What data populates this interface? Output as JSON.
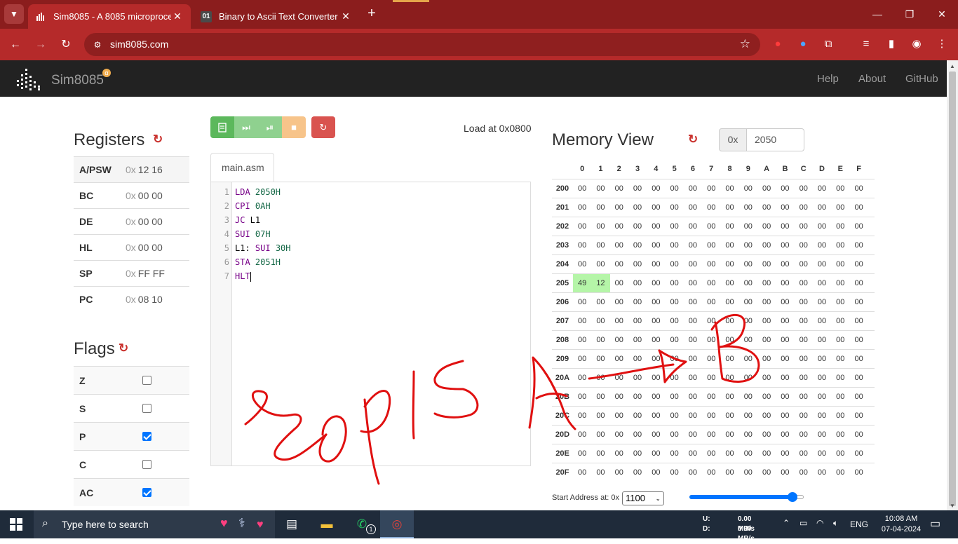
{
  "browser": {
    "tabs": [
      {
        "title": "Sim8085 - A 8085 microprocessor",
        "active": true
      },
      {
        "title": "Binary to Ascii Text Converter",
        "icon_text": "01",
        "active": false
      }
    ],
    "url": "sim8085.com"
  },
  "site": {
    "brand": "Sim8085",
    "nav": [
      "Help",
      "About",
      "GitHub"
    ]
  },
  "registers": {
    "title": "Registers",
    "prefix": "0x",
    "rows": [
      {
        "name": "A/PSW",
        "value": "12 16"
      },
      {
        "name": "BC",
        "value": "00 00"
      },
      {
        "name": "DE",
        "value": "00 00"
      },
      {
        "name": "HL",
        "value": "00 00"
      },
      {
        "name": "SP",
        "value": "FF FF"
      },
      {
        "name": "PC",
        "value": "08 10"
      }
    ]
  },
  "flags": {
    "title": "Flags",
    "rows": [
      {
        "name": "Z",
        "checked": false
      },
      {
        "name": "S",
        "checked": false
      },
      {
        "name": "P",
        "checked": true
      },
      {
        "name": "C",
        "checked": false
      },
      {
        "name": "AC",
        "checked": true
      }
    ]
  },
  "editor": {
    "load_at": "Load at 0x0800",
    "tab": "main.asm",
    "lines": [
      [
        {
          "t": "LDA",
          "c": "kw"
        },
        {
          "t": " 2050H",
          "c": "num"
        }
      ],
      [
        {
          "t": "CPI",
          "c": "kw"
        },
        {
          "t": " 0AH",
          "c": "num"
        }
      ],
      [
        {
          "t": "JC",
          "c": "kw"
        },
        {
          "t": " L1",
          "c": "txt"
        }
      ],
      [
        {
          "t": "SUI",
          "c": "kw"
        },
        {
          "t": " 07H",
          "c": "num"
        }
      ],
      [
        {
          "t": "L1: ",
          "c": "txt"
        },
        {
          "t": "SUI",
          "c": "kw"
        },
        {
          "t": " 30H",
          "c": "num"
        }
      ],
      [
        {
          "t": "STA",
          "c": "kw"
        },
        {
          "t": " 2051H",
          "c": "num"
        }
      ],
      [
        {
          "t": "HLT",
          "c": "kw"
        }
      ]
    ]
  },
  "memory": {
    "title": "Memory View",
    "addr_prefix": "0x",
    "addr_value": "2050",
    "columns": [
      "0",
      "1",
      "2",
      "3",
      "4",
      "5",
      "6",
      "7",
      "8",
      "9",
      "A",
      "B",
      "C",
      "D",
      "E",
      "F"
    ],
    "row_labels": [
      "200",
      "201",
      "202",
      "203",
      "204",
      "205",
      "206",
      "207",
      "208",
      "209",
      "20A",
      "20B",
      "20C",
      "20D",
      "20E",
      "20F"
    ],
    "special": {
      "205": [
        "49",
        "12"
      ]
    },
    "fill": "00",
    "start_address_label": "Start Address at: 0x",
    "start_address_value": "1100",
    "slider_level": 0.9
  },
  "taskbar": {
    "search_placeholder": "Type here to search",
    "net_up": "U:",
    "net_down": "D:",
    "net_up_rate": "0.00 MB/s",
    "net_down_rate": "0.00 MB/s",
    "lang": "ENG",
    "time": "10:08 AM",
    "date": "07-04-2024",
    "whatsapp_badge": "1"
  },
  "colors": {
    "tab_bar": "#8b1d1d",
    "toolbar": "#b52a2a",
    "run_green": "#5cb85c",
    "step_green": "#8fd18f",
    "stop_orange": "#f7c48a",
    "reset_red": "#d9534f",
    "ink_red": "#e01010"
  }
}
